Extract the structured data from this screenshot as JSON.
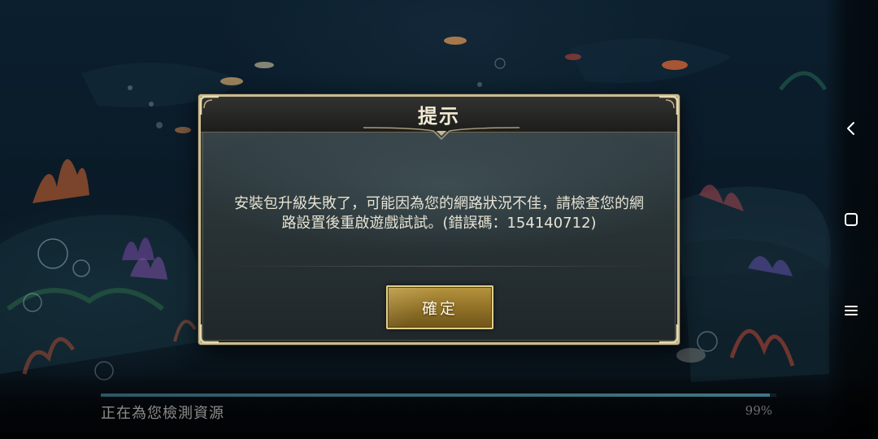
{
  "dialog": {
    "title": "提示",
    "message_line1": "安裝包升級失敗了，可能因為您的網路狀況不佳，請檢查您的網",
    "message_line2": "路設置後重啟遊戲試試。(錯誤碼：154140712)",
    "confirm_label": "確定"
  },
  "loading": {
    "status": "正在為您檢測資源",
    "percent_text": "99%",
    "progress": 0.99
  },
  "nav": {
    "back_icon": "chevron-left-icon",
    "home_icon": "rounded-square-icon",
    "menu_icon": "hamburger-icon"
  },
  "colors": {
    "dialog_border": "#c9bb92",
    "button_gold": "#a88636",
    "progress_fill": "#3f7784"
  }
}
